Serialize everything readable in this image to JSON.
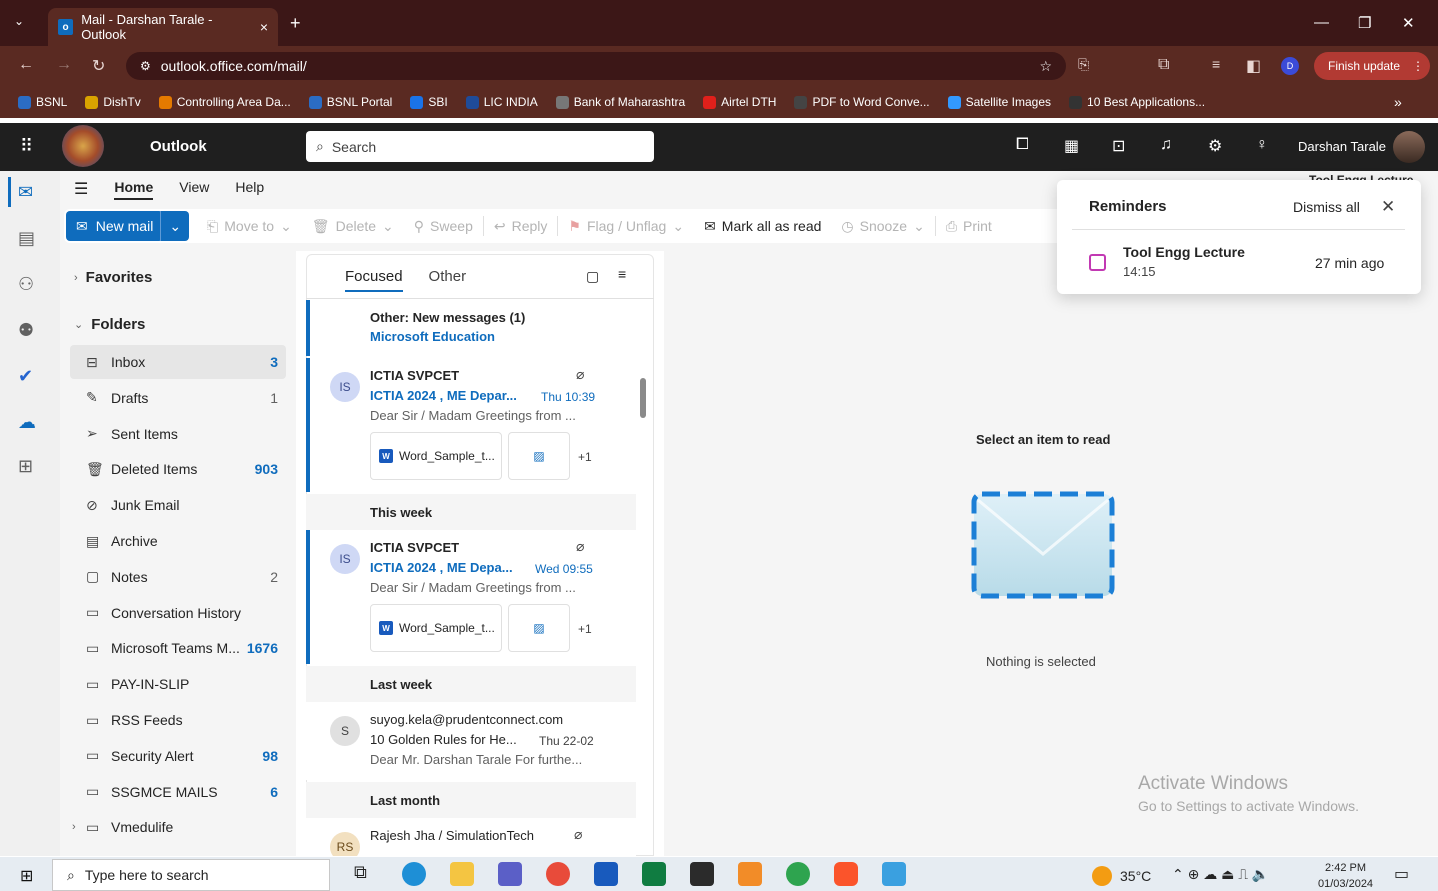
{
  "browser": {
    "tab_title": "Mail - Darshan Tarale - Outlook",
    "tab_close": "×",
    "new_tab": "+",
    "url": "outlook.office.com/mail/",
    "finish_update": "Finish update",
    "profile_initial": "D",
    "bookmarks": [
      {
        "label": "BSNL",
        "color": "#2b6cc4"
      },
      {
        "label": "DishTv",
        "color": "#d9a300"
      },
      {
        "label": "Controlling Area Da...",
        "color": "#e57a00"
      },
      {
        "label": "BSNL Portal",
        "color": "#2b6cc4"
      },
      {
        "label": "SBI",
        "color": "#1a73e8"
      },
      {
        "label": "LIC INDIA",
        "color": "#1f4b99"
      },
      {
        "label": "Bank of Maharashtra",
        "color": "#777777"
      },
      {
        "label": "Airtel DTH",
        "color": "#e0201b"
      },
      {
        "label": "PDF to Word Conve...",
        "color": "#444444"
      },
      {
        "label": "Satellite Images",
        "color": "#3399ff"
      },
      {
        "label": "10 Best Applications...",
        "color": "#333333"
      }
    ],
    "bookmarks_more": "»"
  },
  "header": {
    "app_name": "Outlook",
    "search_placeholder": "Search",
    "user_name": "Darshan Tarale"
  },
  "ribbon": {
    "tabs": [
      "Home",
      "View",
      "Help"
    ],
    "new_mail": "New mail",
    "move_to": "Move to",
    "delete": "Delete",
    "sweep": "Sweep",
    "reply": "Reply",
    "flag": "Flag / Unflag",
    "mark_all_read": "Mark all as read",
    "snooze": "Snooze",
    "print": "Print"
  },
  "folders": {
    "favorites_label": "Favorites",
    "folders_label": "Folders",
    "items": [
      {
        "name": "Inbox",
        "count": "3",
        "icon": "inbox-icon",
        "glyph": "⊟",
        "bold": true,
        "selected": true
      },
      {
        "name": "Drafts",
        "count": "1",
        "icon": "drafts-icon",
        "glyph": "✎",
        "bold": false
      },
      {
        "name": "Sent Items",
        "count": "",
        "icon": "sent-icon",
        "glyph": "➢",
        "bold": false
      },
      {
        "name": "Deleted Items",
        "count": "903",
        "icon": "trash-icon",
        "glyph": "🗑",
        "bold": true
      },
      {
        "name": "Junk Email",
        "count": "",
        "icon": "junk-icon",
        "glyph": "⊘",
        "bold": false
      },
      {
        "name": "Archive",
        "count": "",
        "icon": "archive-icon",
        "glyph": "▤",
        "bold": false
      },
      {
        "name": "Notes",
        "count": "2",
        "icon": "notes-icon",
        "glyph": "▢",
        "bold": false
      },
      {
        "name": "Conversation History",
        "count": "",
        "icon": "folder-icon",
        "glyph": "▭",
        "bold": false
      },
      {
        "name": "Microsoft Teams M...",
        "count": "1676",
        "icon": "folder-icon",
        "glyph": "▭",
        "bold": true
      },
      {
        "name": "PAY-IN-SLIP",
        "count": "",
        "icon": "folder-icon",
        "glyph": "▭",
        "bold": false
      },
      {
        "name": "RSS Feeds",
        "count": "",
        "icon": "folder-icon",
        "glyph": "▭",
        "bold": false
      },
      {
        "name": "Security Alert",
        "count": "98",
        "icon": "folder-icon",
        "glyph": "▭",
        "bold": true
      },
      {
        "name": "SSGMCE MAILS",
        "count": "6",
        "icon": "folder-icon",
        "glyph": "▭",
        "bold": true
      },
      {
        "name": "Vmedulife",
        "count": "",
        "icon": "folder-icon",
        "glyph": "▭",
        "bold": false
      }
    ]
  },
  "list": {
    "tab_focused": "Focused",
    "tab_other": "Other",
    "other_notice_title": "Other: New messages (1)",
    "other_notice_sender": "Microsoft Education",
    "section_this_week": "This week",
    "section_last_week": "Last week",
    "section_last_month": "Last month",
    "messages": [
      {
        "initials": "IS",
        "sender": "ICTIA SVPCET",
        "subject": "ICTIA 2024 , ME Depar...",
        "time": "Thu 10:39",
        "preview": "Dear Sir / Madam Greetings from ...",
        "attachment": "Word_Sample_t...",
        "more": "+1"
      },
      {
        "initials": "IS",
        "sender": "ICTIA SVPCET",
        "subject": "ICTIA 2024 , ME Depa...",
        "time": "Wed 09:55",
        "preview": "Dear Sir / Madam Greetings from ...",
        "attachment": "Word_Sample_t...",
        "more": "+1"
      },
      {
        "initials": "S",
        "sender": "suyog.kela@prudentconnect.com",
        "subject": "10 Golden Rules for He...",
        "time": "Thu 22-02",
        "preview": "Dear Mr. Darshan Tarale For furthe..."
      },
      {
        "initials": "RS",
        "sender": "Rajesh Jha / SimulationTech",
        "subject": "",
        "time": "",
        "preview": ""
      }
    ]
  },
  "reading": {
    "select_item": "Select an item to read",
    "nothing_selected": "Nothing is selected",
    "activate_title": "Activate Windows",
    "activate_sub": "Go to Settings to activate Windows."
  },
  "reminders": {
    "title": "Reminders",
    "dismiss_all": "Dismiss all",
    "event_name": "Tool Engg Lecture",
    "event_time": "14:15",
    "ago": "27 min ago",
    "peek": "Tool Engg Lecture"
  },
  "taskbar": {
    "search_placeholder": "Type here to search",
    "temperature": "35°C",
    "time": "2:42 PM",
    "date": "01/03/2024"
  }
}
